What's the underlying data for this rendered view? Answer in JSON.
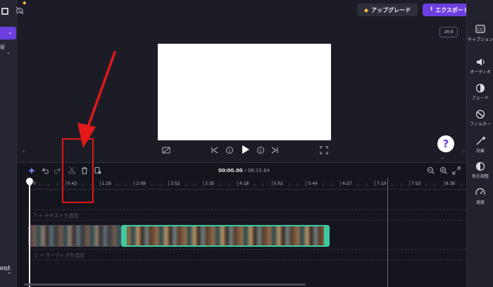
{
  "header": {
    "upgrade_label": "アップグレード",
    "export_label": "エクスポート",
    "aspect_ratio": "16:9"
  },
  "left_panel": {
    "fragment_label": "替",
    "bottom_text": "ent"
  },
  "right_panel": {
    "items": [
      {
        "label": "キャプション",
        "icon": "cc-icon"
      },
      {
        "label": "オーディオ",
        "icon": "speaker-icon"
      },
      {
        "label": "フェード",
        "icon": "fade-icon"
      },
      {
        "label": "フィルター",
        "icon": "filter-icon"
      },
      {
        "label": "効果",
        "icon": "magic-wand-icon"
      },
      {
        "label": "色を調整",
        "icon": "color-adjust-icon"
      },
      {
        "label": "速度",
        "icon": "speedometer-icon"
      }
    ]
  },
  "help": {
    "label": "?"
  },
  "timeline": {
    "current_time": "00:00.00",
    "total_time": "/ 06:15.64",
    "ruler_ticks": [
      "0",
      "0:43",
      "1:26",
      "2:09",
      "2:52",
      "3:35",
      "4:18",
      "5:01",
      "5:44",
      "6:27",
      "7:10",
      "7:53",
      "8:36"
    ],
    "text_track_placeholder": "+ テキストを追加",
    "audio_track_placeholder": "+ オーディオを追加"
  },
  "colors": {
    "accent": "#6d3fe0",
    "annotation": "#e31818",
    "clip_selected_border": "#3ec9a0"
  }
}
